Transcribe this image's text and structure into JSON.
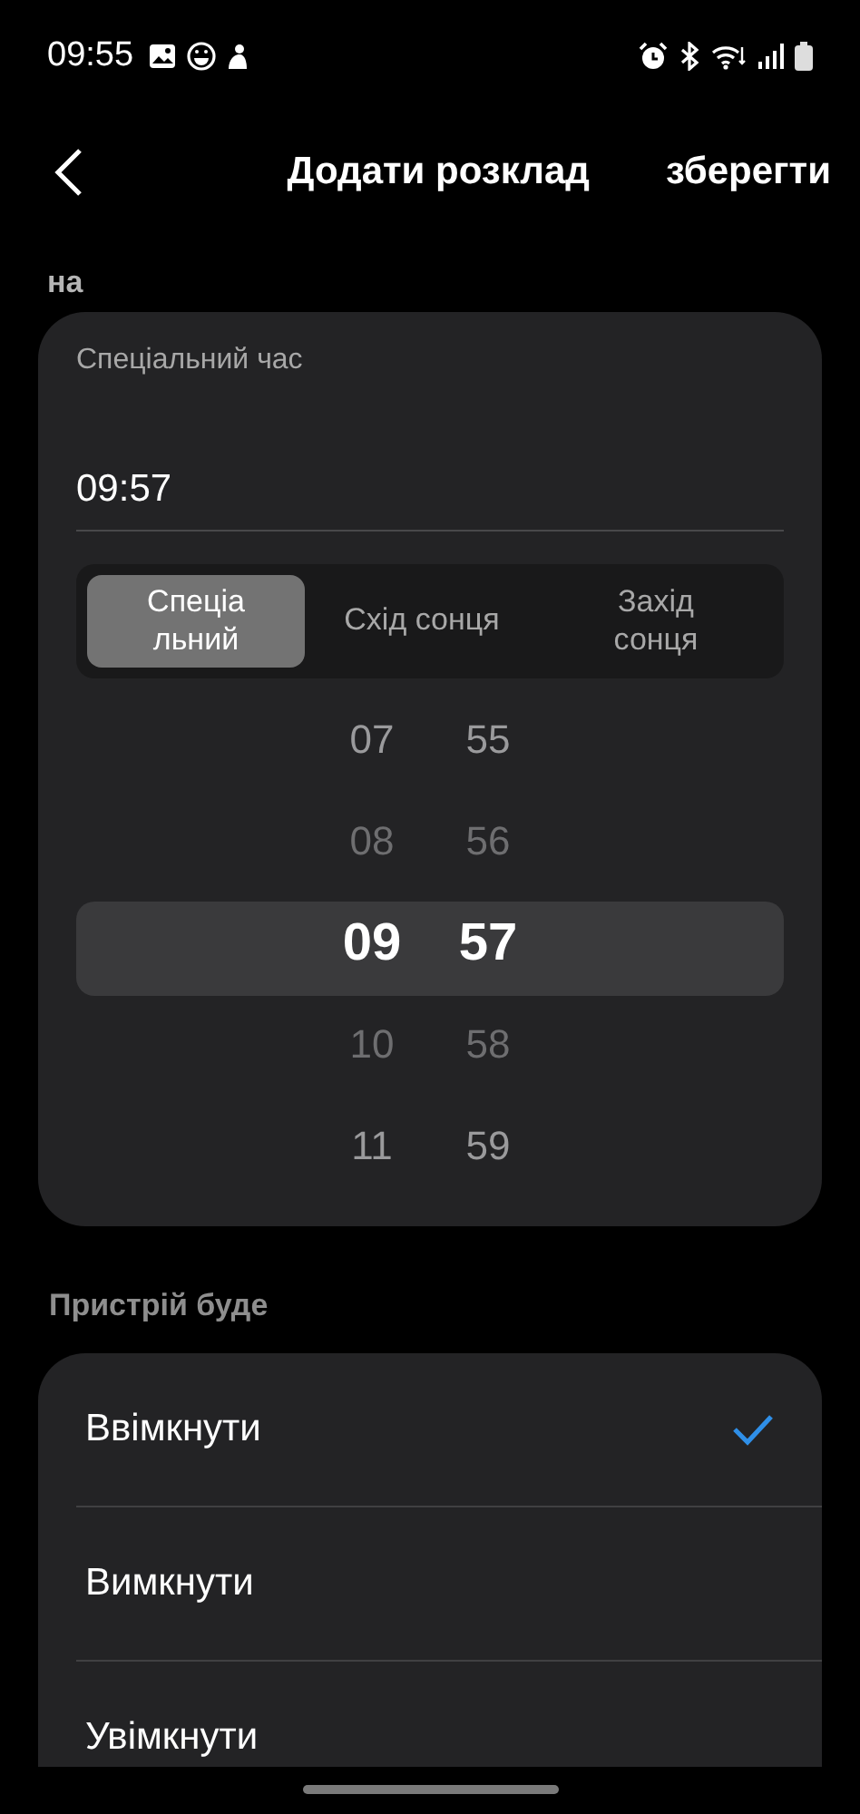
{
  "status_bar": {
    "time": "09:55"
  },
  "header": {
    "title": "Додати розклад",
    "save": "зберегти"
  },
  "section_label": "на",
  "time_card": {
    "label": "Спеціальний час",
    "value": "09:57",
    "modes": [
      {
        "label": "Спеціальний",
        "selected": true
      },
      {
        "label": "Схід сонця",
        "selected": false
      },
      {
        "label": "Захід сонця",
        "selected": false
      }
    ],
    "hours": [
      {
        "value": "07",
        "selected": false
      },
      {
        "value": "08",
        "selected": false
      },
      {
        "value": "09",
        "selected": true
      },
      {
        "value": "10",
        "selected": false
      },
      {
        "value": "11",
        "selected": false
      }
    ],
    "minutes": [
      {
        "value": "55",
        "selected": false
      },
      {
        "value": "56",
        "selected": false
      },
      {
        "value": "57",
        "selected": true
      },
      {
        "value": "58",
        "selected": false
      },
      {
        "value": "59",
        "selected": false
      }
    ]
  },
  "device_label": "Пристрій буде",
  "options": [
    {
      "label": "Ввімкнути",
      "selected": true
    },
    {
      "label": "Вимкнути",
      "selected": false
    },
    {
      "label": "Увімкнути",
      "selected": false
    }
  ]
}
